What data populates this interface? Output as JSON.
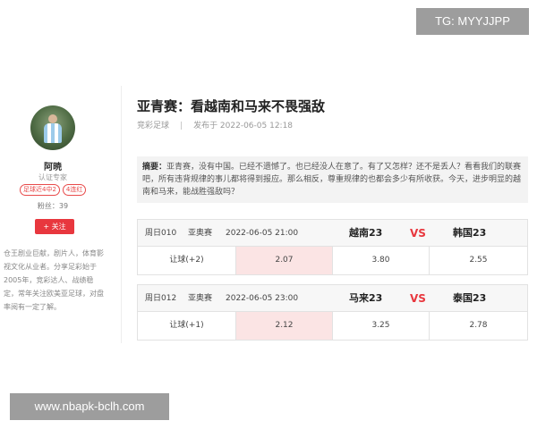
{
  "watermarks": {
    "top": "TG: MYYJJPP",
    "bottom": "www.nbapk-bclh.com"
  },
  "author": {
    "name": "阿暁",
    "title": "认证专家",
    "badges": [
      "足球近4中2",
      "4连红"
    ],
    "fans": "粉丝：39",
    "follow_label": "+ 关注",
    "bio": "仓王剧业巨献，剧片人，体育影视文化从业者。分享足彩始于2005年，竞彩达人、战绩稳定，常年关注欧美亚足球，对盘率阅有一定了解。"
  },
  "article": {
    "title": "亚青赛：看越南和马来不畏强敌",
    "category": "竞彩足球",
    "separator": "|",
    "published": "发布于 2022-06-05 12:18",
    "summary_label": "摘要：",
    "summary_text": "亚青赛，没有中国。已经不遗憾了。也已经没人在意了。有了又怎样？还不是丢人？看看我们的联赛吧，所有违背规律的事儿都将得到报应。那么相反，尊重规律的也都会多少有所收获。今天，进步明显的越南和马来，能战胜强敌吗？"
  },
  "matches": [
    {
      "code": "周日010",
      "league": "亚奥赛",
      "time": "2022-06-05 21:00",
      "home": "越南23",
      "vs": "VS",
      "away": "韩国23",
      "handicap": "让球(+2)",
      "odds": [
        "2.07",
        "3.80",
        "2.55"
      ]
    },
    {
      "code": "周日012",
      "league": "亚奥赛",
      "time": "2022-06-05 23:00",
      "home": "马来23",
      "vs": "VS",
      "away": "泰国23",
      "handicap": "让球(+1)",
      "odds": [
        "2.12",
        "3.25",
        "2.78"
      ]
    }
  ]
}
